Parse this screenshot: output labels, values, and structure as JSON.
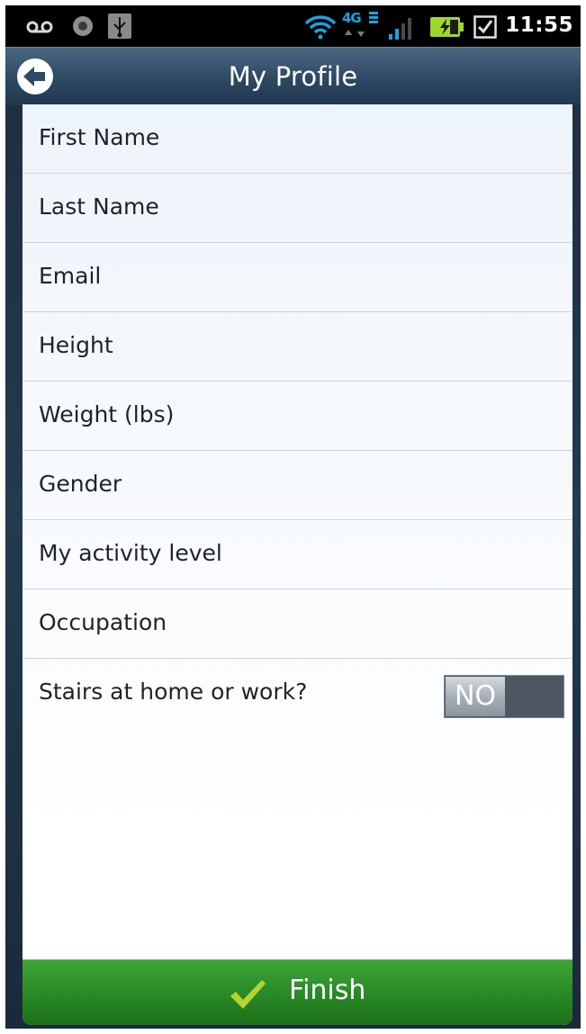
{
  "status_bar": {
    "time": "11:55",
    "network_badge": "4G",
    "icons": [
      "voicemail-icon",
      "circle-notification-icon",
      "usb-icon",
      "wifi-icon",
      "4g-lte-icon",
      "signal-icon",
      "battery-charging-icon",
      "checkbox-notification-icon"
    ]
  },
  "header": {
    "title": "My Profile",
    "back_icon": "back-arrow-icon"
  },
  "form": {
    "fields": [
      {
        "label": "First Name"
      },
      {
        "label": "Last Name"
      },
      {
        "label": "Email"
      },
      {
        "label": "Height"
      },
      {
        "label": "Weight (lbs)"
      },
      {
        "label": "Gender"
      },
      {
        "label": "My activity level"
      },
      {
        "label": "Occupation"
      }
    ],
    "stairs": {
      "label": "Stairs at home or work?",
      "toggle_value": "NO"
    }
  },
  "footer": {
    "finish_label": "Finish",
    "finish_icon": "checkmark-icon"
  },
  "colors": {
    "header": "#2c4863",
    "finish": "#2b8e28",
    "checkmark": "#b5d334",
    "panel": "#f4f8fc"
  }
}
